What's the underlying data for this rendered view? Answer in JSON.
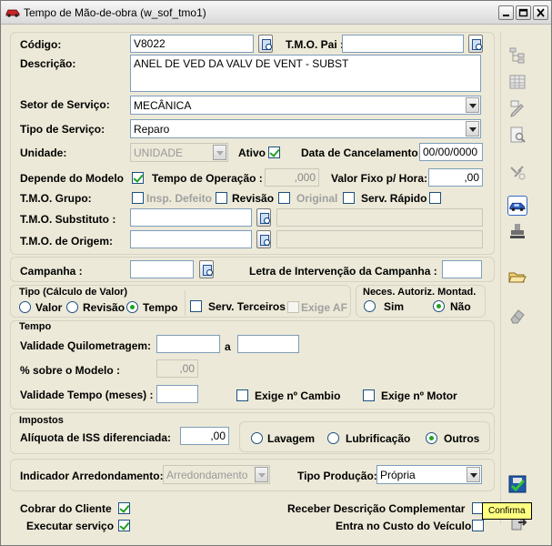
{
  "window": {
    "title": "Tempo de Mão-de-obra (w_sof_tmo1)"
  },
  "form": {
    "codigo_label": "Código:",
    "codigo_value": "V8022",
    "tmo_pai_label": "T.M.O. Pai :",
    "tmo_pai_value": "",
    "descricao_label": "Descrição:",
    "descricao_value": "ANEL DE VED DA VALV DE VENT - SUBST",
    "setor_label": "Setor de Serviço:",
    "setor_value": "MECÂNICA",
    "tipo_label": "Tipo de Serviço:",
    "tipo_value": "Reparo",
    "unidade_label": "Unidade:",
    "unidade_value": "UNIDADE",
    "ativo_label": "Ativo",
    "data_cancel_label": "Data de Cancelamento:",
    "data_cancel_value": "00/00/0000",
    "depende_label": "Depende do Modelo",
    "tempo_op_label": "Tempo de Operação :",
    "tempo_op_value": ",000",
    "valor_fixo_label": "Valor Fixo p/ Hora:",
    "valor_fixo_value": ",00",
    "tmo_grupo_label": "T.M.O. Grupo:",
    "insp_defeito_label": "Insp. Defeito",
    "revisao_label": "Revisão",
    "original_label": "Original",
    "serv_rapido_label": "Serv. Rápido",
    "tmo_substituto_label": "T.M.O. Substituto :",
    "tmo_origem_label": "T.M.O. de Origem:"
  },
  "campanha": {
    "campanha_label": "Campanha :",
    "letra_label": "Letra de Intervenção da Campanha :"
  },
  "tipo_calculo": {
    "title": "Tipo (Cálculo de Valor)",
    "opt_valor": "Valor",
    "opt_revisao": "Revisão",
    "opt_tempo": "Tempo",
    "selected": "Tempo",
    "serv_terceiros": "Serv. Terceiros",
    "exige_af": "Exige AF"
  },
  "autoriz": {
    "title": "Neces. Autoriz. Montad.",
    "opt_sim": "Sim",
    "opt_nao": "Não",
    "selected": "Não"
  },
  "tempo": {
    "title": "Tempo",
    "validade_km_label": "Validade Quilometragem:",
    "a_label": "a",
    "percent_label": "% sobre o Modelo :",
    "percent_value": ",00",
    "validade_tempo_label": "Validade Tempo (meses) :",
    "exige_cambio": "Exige nº Cambio",
    "exige_motor": "Exige nº Motor"
  },
  "impostos": {
    "title": "Impostos",
    "aliquota_label": "Alíquota de ISS diferenciada:",
    "aliquota_value": ",00",
    "opt_lavagem": "Lavagem",
    "opt_lubrificacao": "Lubrificação",
    "opt_outros": "Outros",
    "selected": "Outros"
  },
  "bottom": {
    "indicador_label": "Indicador Arredondamento:",
    "indicador_value": "Arredondamento",
    "tipo_producao_label": "Tipo Produção:",
    "tipo_producao_value": "Própria",
    "cobrar_label": "Cobrar do Cliente",
    "executar_label": "Executar serviço",
    "receber_label": "Receber Descrição Complementar",
    "entra_custo_label": "Entra no Custo do Veículo"
  },
  "tooltip": {
    "text": "Confirma"
  },
  "colors": {
    "accent_green": "#21A121",
    "border_blue": "#7F9DB9",
    "window_bg": "#ECE9D8"
  }
}
